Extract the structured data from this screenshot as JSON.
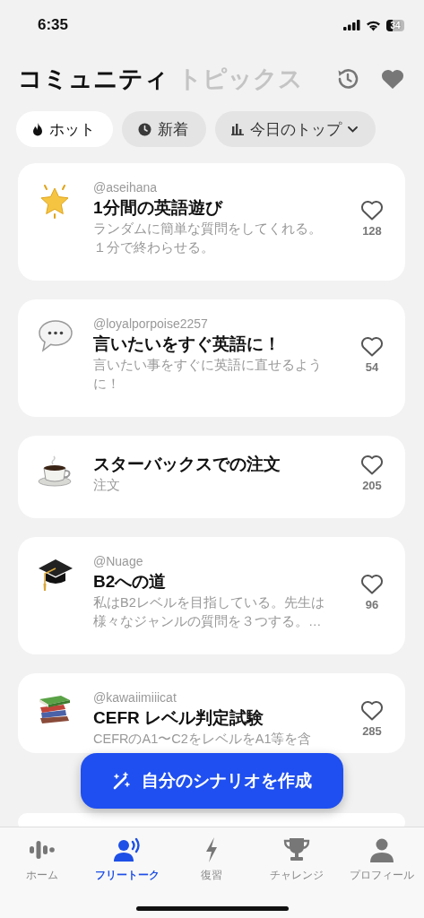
{
  "status_bar": {
    "time": "6:35",
    "battery": "34"
  },
  "header": {
    "tabs": [
      {
        "label": "コミュニティ",
        "selected": true
      },
      {
        "label": "トピックス",
        "selected": false
      }
    ]
  },
  "filters": [
    {
      "label": "ホット",
      "kind": "flame",
      "selected": true,
      "dropdown": false
    },
    {
      "label": "新着",
      "kind": "clock",
      "selected": false,
      "dropdown": false
    },
    {
      "label": "今日のトップ",
      "kind": "bars",
      "selected": false,
      "dropdown": true
    }
  ],
  "cards": [
    {
      "kind": "star",
      "user": "@aseihana",
      "title": "1分間の英語遊び",
      "description": "ランダムに簡単な質問をしてくれる。１分で終わらせる。",
      "likes": "128"
    },
    {
      "kind": "speech",
      "user": "@loyalporpoise2257",
      "title": "言いたいをすぐ英語に！",
      "description": "言いたい事をすぐに英語に直せるように！",
      "likes": "54"
    },
    {
      "kind": "coffee",
      "title": "スターバックスでの注文",
      "description": "注文",
      "likes": "205"
    },
    {
      "kind": "cap",
      "user": "@Nuage",
      "title": "B2への道",
      "description": "私はB2レベルを目指している。先生は様々なジャンルの質問を３つする。…",
      "likes": "96"
    },
    {
      "kind": "books",
      "user": "@kawaiimiiicat",
      "title": "CEFR レベル判定試験",
      "description": "CEFRのA1〜C2をレベルをA1等を含",
      "likes": "285"
    }
  ],
  "create_button": {
    "label": "自分のシナリオを作成"
  },
  "nav": [
    {
      "label": "ホーム",
      "kind": "wave",
      "selected": false
    },
    {
      "label": "フリートーク",
      "kind": "talk",
      "selected": true
    },
    {
      "label": "復習",
      "kind": "bolt",
      "selected": false
    },
    {
      "label": "チャレンジ",
      "kind": "trophy",
      "selected": false
    },
    {
      "label": "プロフィール",
      "kind": "person",
      "selected": false
    }
  ]
}
